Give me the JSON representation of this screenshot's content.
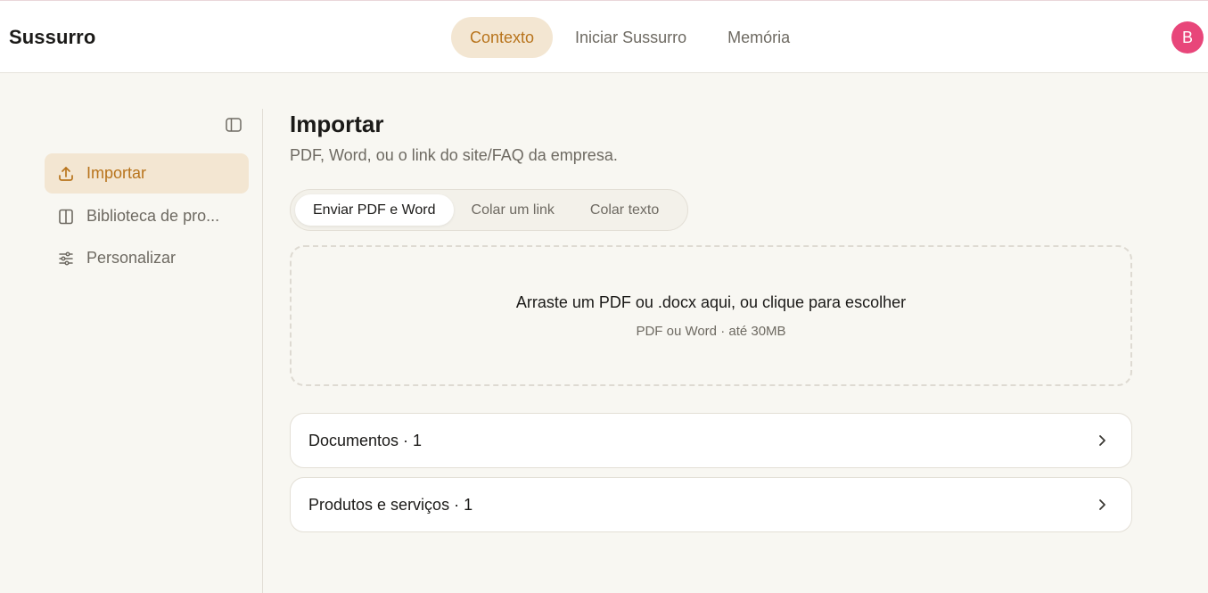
{
  "header": {
    "brand": "Sussurro",
    "nav": [
      {
        "label": "Contexto",
        "active": true
      },
      {
        "label": "Iniciar Sussurro",
        "active": false
      },
      {
        "label": "Memória",
        "active": false
      }
    ],
    "avatar_initial": "B"
  },
  "sidebar": {
    "collapse_icon": "sidebar-toggle-icon",
    "items": [
      {
        "label": "Importar",
        "icon": "upload-icon",
        "active": true
      },
      {
        "label": "Biblioteca de pro...",
        "icon": "book-icon",
        "active": false
      },
      {
        "label": "Personalizar",
        "icon": "sliders-icon",
        "active": false
      }
    ]
  },
  "main": {
    "title": "Importar",
    "subtitle": "PDF, Word, ou o link do site/FAQ da empresa.",
    "tabs": [
      {
        "label": "Enviar PDF e Word",
        "active": true
      },
      {
        "label": "Colar um link",
        "active": false
      },
      {
        "label": "Colar texto",
        "active": false
      }
    ],
    "dropzone": {
      "title": "Arraste um PDF ou .docx aqui, ou clique para escolher",
      "hint": "PDF ou Word · até 30MB"
    },
    "sections": [
      {
        "label": "Documentos · 1"
      },
      {
        "label": "Produtos e serviços · 1"
      }
    ]
  },
  "colors": {
    "accent": "#b8741c",
    "accent_bg": "#f3e6d2",
    "avatar": "#e8467a",
    "background": "#f8f7f2"
  }
}
